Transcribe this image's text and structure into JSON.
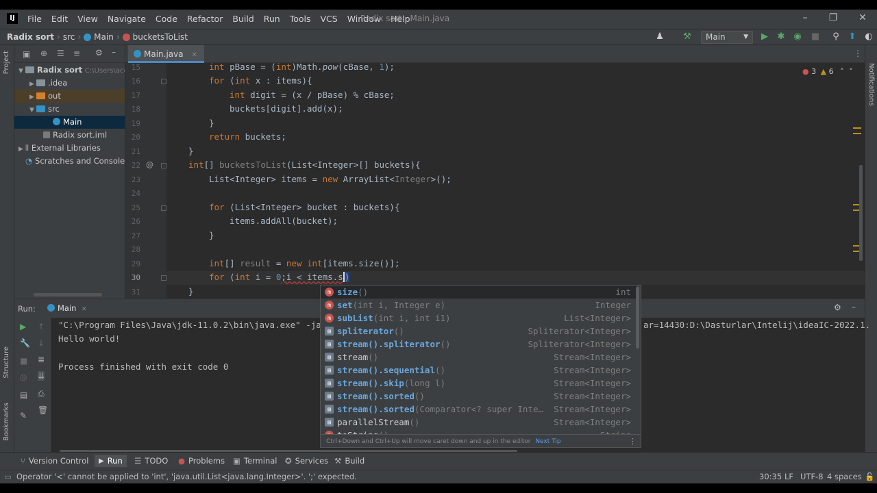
{
  "app": {
    "window_title": "Radix sort - Main.java",
    "logo": "IJ"
  },
  "menu": [
    "File",
    "Edit",
    "View",
    "Navigate",
    "Code",
    "Refactor",
    "Build",
    "Run",
    "Tools",
    "VCS",
    "Window",
    "Help"
  ],
  "breadcrumb": {
    "project": "Radix sort",
    "folder": "src",
    "class": "Main",
    "method": "bucketsToList"
  },
  "run_config": "Main",
  "project_tree": {
    "tool_label": "Project",
    "items": [
      {
        "label": "Radix sort",
        "hint": "C:\\Users\\ace"
      },
      {
        "label": ".idea"
      },
      {
        "label": "out"
      },
      {
        "label": "src"
      },
      {
        "label": "Main"
      },
      {
        "label": "Radix sort.iml"
      },
      {
        "label": "External Libraries"
      },
      {
        "label": "Scratches and Consoles"
      }
    ]
  },
  "editor": {
    "tab": "Main.java",
    "errors": "3",
    "warnings": "6",
    "line_numbers": [
      "15",
      "16",
      "17",
      "18",
      "19",
      "20",
      "21",
      "22",
      "23",
      "24",
      "25",
      "26",
      "27",
      "28",
      "29",
      "30",
      "31"
    ]
  },
  "run": {
    "label": "Run:",
    "tab": "Main",
    "output": [
      "\"C:\\Program Files\\Java\\jdk-11.0.2\\bin\\java.exe\" -ja",
      "Hello world!",
      "",
      "Process finished with exit code 0"
    ],
    "output_right": "ar=14430:D:\\Dasturlar\\Intelij\\ideaIC-2022.1."
  },
  "completion": {
    "items": [
      {
        "name": "size",
        "params": "()",
        "ret": "int",
        "icon": "m"
      },
      {
        "name": "set",
        "params": "(int i, Integer e)",
        "ret": "Integer",
        "icon": "m"
      },
      {
        "name": "subList",
        "params": "(int i, int i1)",
        "ret": "List<Integer>",
        "icon": "m"
      },
      {
        "name": "spliterator",
        "params": "()",
        "ret": "Spliterator<Integer>",
        "icon": "c"
      },
      {
        "name": "stream().spliterator",
        "params": "()",
        "ret": "Spliterator<Integer>",
        "icon": "c"
      },
      {
        "name": "stream",
        "params": "()",
        "ret": "Stream<Integer>",
        "icon": "c"
      },
      {
        "name": "stream().sequential",
        "params": "()",
        "ret": "Stream<Integer>",
        "icon": "c"
      },
      {
        "name": "stream().skip",
        "params": "(long l)",
        "ret": "Stream<Integer>",
        "icon": "c"
      },
      {
        "name": "stream().sorted",
        "params": "()",
        "ret": "Stream<Integer>",
        "icon": "c"
      },
      {
        "name": "stream().sorted",
        "params": "(Comparator<? super Inte…",
        "ret": "Stream<Integer>",
        "icon": "c"
      },
      {
        "name": "parallelStream",
        "params": "()",
        "ret": "Stream<Integer>",
        "icon": "c"
      },
      {
        "name": "toString",
        "params": "()",
        "ret": "String",
        "icon": "m"
      }
    ],
    "footer": "Ctrl+Down and Ctrl+Up will move caret down and up in the editor",
    "footer_link": "Next Tip"
  },
  "bottom_tabs": [
    "Version Control",
    "Run",
    "TODO",
    "Problems",
    "Terminal",
    "Services",
    "Build"
  ],
  "side_labels": {
    "structure": "Structure",
    "bookmarks": "Bookmarks",
    "notifications": "Notifications"
  },
  "status": {
    "message": "Operator '<' cannot be applied to 'int', 'java.util.List<java.lang.Integer>'. ';' expected.",
    "position": "30:35",
    "line_sep": "LF",
    "encoding": "UTF-8",
    "indent": "4 spaces"
  },
  "colors": {
    "accent": "#4a88c7",
    "keyword": "#cc7832",
    "error": "#bc3f3c",
    "warning": "#be9117",
    "run_green": "#59a869"
  }
}
